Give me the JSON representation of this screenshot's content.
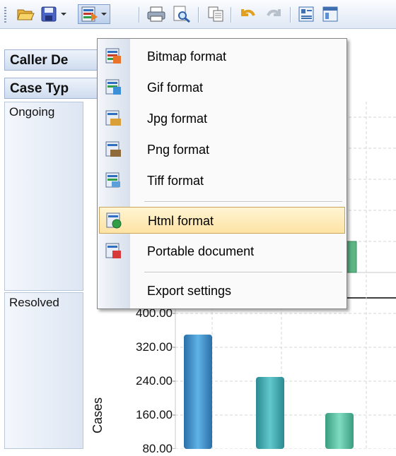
{
  "toolbar": {
    "icons": [
      "open-folder-icon",
      "save-icon",
      "export-icon",
      "print-icon",
      "print-preview-icon",
      "copy-icon",
      "undo-icon",
      "redo-icon",
      "field-list-icon",
      "chart-options-icon"
    ]
  },
  "fields": {
    "caller_header": "Caller De",
    "case_type_header": "Case Typ"
  },
  "rows": {
    "ongoing": "Ongoing",
    "resolved": "Resolved"
  },
  "chart_data": {
    "type": "bar",
    "ylabel": "Cases",
    "yticks": [
      "400.00",
      "320.00",
      "240.00",
      "160.00",
      "80.00"
    ],
    "ylim": [
      0,
      400
    ],
    "series": [
      {
        "values": [
          350,
          250,
          165
        ]
      }
    ],
    "grid": true
  },
  "menu": {
    "items": [
      {
        "label": "Bitmap format",
        "icon": "bitmap-icon"
      },
      {
        "label": "Gif format",
        "icon": "gif-icon"
      },
      {
        "label": "Jpg format",
        "icon": "jpg-icon"
      },
      {
        "label": "Png format",
        "icon": "png-icon"
      },
      {
        "label": "Tiff format",
        "icon": "tiff-icon"
      },
      {
        "label": "Html format",
        "icon": "html-icon"
      },
      {
        "label": "Portable document",
        "icon": "pdf-icon"
      },
      {
        "label": "Export settings",
        "icon": ""
      }
    ]
  },
  "colors": {
    "bar_blue": "#3c8fc7",
    "bar_teal": "#3aa7ae",
    "bar_green": "#55c0a0",
    "menu_highlight": "#fde3a4"
  }
}
